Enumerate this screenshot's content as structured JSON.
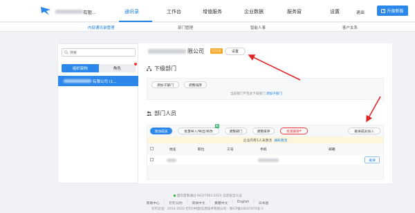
{
  "header": {
    "company_suffix": "有限...",
    "tabs": [
      {
        "label": "通讯录",
        "active": true
      },
      {
        "label": "工作台",
        "active": false
      },
      {
        "label": "增值服务",
        "active": false
      },
      {
        "label": "企业数据",
        "active": false
      },
      {
        "label": "服务窗",
        "active": false
      }
    ],
    "settings_label": "设置",
    "logout_label": "退出",
    "upgrade_label": "升级新版",
    "accent_color": "#1a7ee6"
  },
  "subnav": {
    "items": [
      {
        "label": "内部通讯录管理",
        "active": true
      },
      {
        "label": "部门管理",
        "active": false
      },
      {
        "label": "智能人事",
        "active": false
      },
      {
        "label": "客户关系",
        "active": false
      }
    ]
  },
  "sidebar": {
    "search_placeholder": "搜索",
    "segments": [
      "组织架构",
      "角色"
    ],
    "tree_item_suffix": "有限公司 (1..."
  },
  "main": {
    "org_name_suffix": "限公司",
    "org_tag": "已认证",
    "settings_button": "设置",
    "sub_dept": {
      "title": "下级部门",
      "buttons": [
        "添加子部门",
        "调整排序"
      ],
      "hint": "当前部门不包含下级部门",
      "hint_link": "添加子部门"
    },
    "members": {
      "title": "部门人员",
      "buttons": [
        "添加成员",
        "批量导入/导出/修改",
        "调整部门",
        "调整排序",
        "批量删除"
      ],
      "batch_badge": "新",
      "invite_button": "邀请成员加入",
      "notice": "企业内有1人未激活",
      "notice_link": "通知激活",
      "columns": [
        "姓名",
        "职位",
        "工号",
        "手机",
        "邮箱"
      ],
      "row_action": "邀请"
    }
  },
  "footer": {
    "line1": "国内首家通过 ISO27001:2013 信息安全认证",
    "links": [
      "帮助中心",
      "钉钉公约",
      "简体中文",
      "繁體中文",
      "English",
      "日本語"
    ],
    "line3": "钉钉企业 · 2014-2022 钉钉(中国)信息技术有限公司 · 浙ICP备18037475号-1"
  }
}
